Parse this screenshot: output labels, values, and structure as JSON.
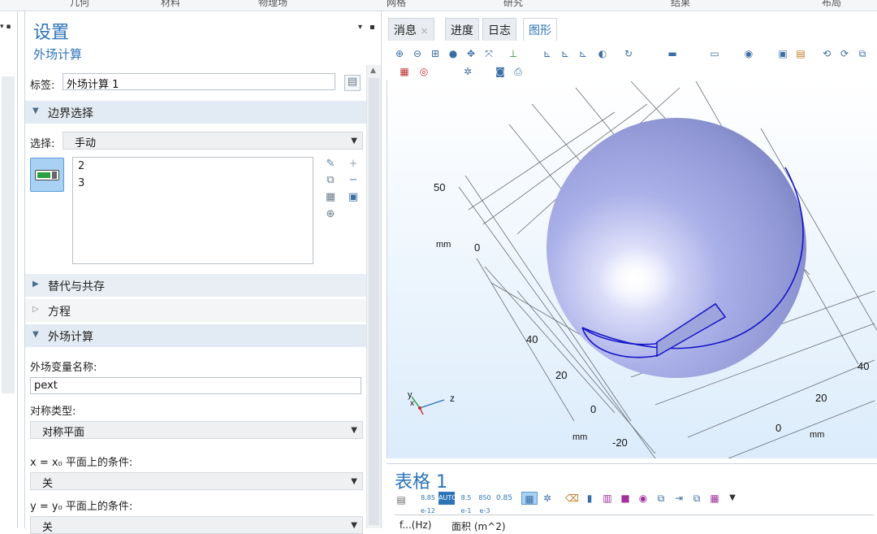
{
  "ribbon": {
    "tabs": [
      "几何",
      "材料",
      "物理场",
      "网格",
      "研究",
      "结果",
      "布局"
    ]
  },
  "settings": {
    "title": "设置",
    "subtitle": "外场计算",
    "label_caption": "标签:",
    "label_value": "外场计算 1",
    "sections": {
      "boundary": "边界选择",
      "override": "替代与共存",
      "equation": "方程",
      "farfield": "外场计算"
    },
    "selection_caption": "选择:",
    "selection_value": "手动",
    "selection_items": [
      "2",
      "3"
    ],
    "variable_name_caption": "外场变量名称:",
    "variable_name_value": "pext",
    "symmetry_caption": "对称类型:",
    "symmetry_value": "对称平面",
    "x_condition_caption": "x = x₀ 平面上的条件:",
    "x_condition_value": "关",
    "y_condition_caption": "y = y₀ 平面上的条件:",
    "y_condition_value": "关"
  },
  "graphics": {
    "tabs": [
      "消息",
      "进度",
      "日志",
      "图形"
    ],
    "active_tab": "图形",
    "axis_labels": {
      "left_50": "50",
      "left_0": "0",
      "left_mm": "mm",
      "mid_40": "40",
      "mid_20": "20",
      "mid_0": "0",
      "mid_neg20": "-20",
      "mid_mm": "mm",
      "right_40": "40",
      "right_20": "20",
      "right_0": "0",
      "right_mm": "mm"
    },
    "triad": {
      "z": "z",
      "y": "y",
      "x": "x"
    },
    "sphere_color": "#b8bbef",
    "edge_color": "#1414c8"
  },
  "table": {
    "title": "表格 1",
    "toolbar": [
      "8.85 e-12",
      "AUTO",
      "8.5 e-1",
      "850 e-3",
      "0.85"
    ],
    "headers": [
      "f...(Hz)",
      "面积 (m^2)"
    ]
  }
}
